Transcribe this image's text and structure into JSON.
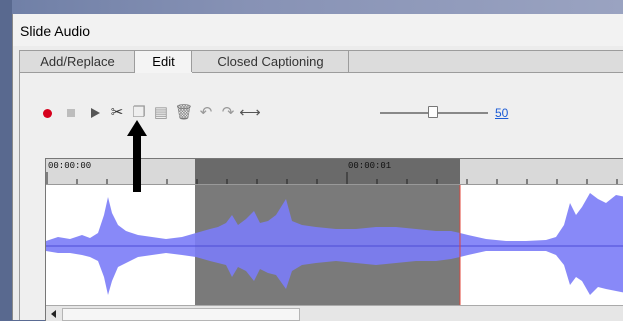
{
  "window": {
    "title": "Slide Audio"
  },
  "tabs": [
    {
      "label": "Add/Replace",
      "active": false
    },
    {
      "label": "Edit",
      "active": true
    },
    {
      "label": "Closed Captioning",
      "active": false
    }
  ],
  "toolbar": {
    "icons": [
      "record-icon",
      "stop-icon",
      "play-icon",
      "cut-icon",
      "copy-icon",
      "paste-icon",
      "delete-icon",
      "undo-icon",
      "redo-icon",
      "fit-icon"
    ],
    "volume_value": "50",
    "volume_level": 0.5
  },
  "timeline": {
    "labels": [
      "00:00:00",
      "00:00:01"
    ]
  },
  "colors": {
    "waveform": "#7b7cf7",
    "selection": "#7a7a7a",
    "playhead": "#e0443a",
    "record": "#d6001c"
  }
}
